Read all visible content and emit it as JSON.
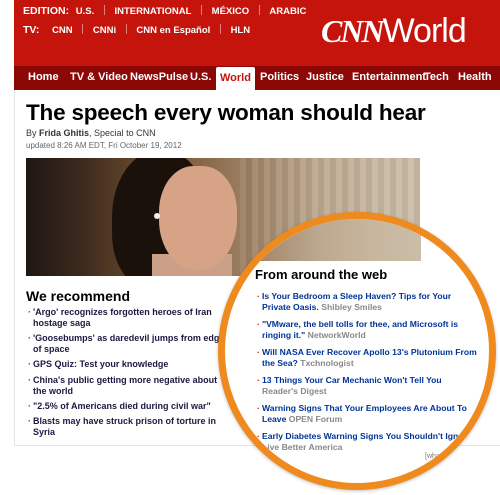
{
  "header": {
    "edition_label": "EDITION:",
    "edition_current": "U.S.",
    "editions": [
      "INTERNATIONAL",
      "MÉXICO",
      "ARABIC"
    ],
    "tv_label": "TV:",
    "tv_channels": [
      "CNN",
      "CNNi",
      "CNN en Español",
      "HLN"
    ],
    "logo_cnn": "CNN",
    "logo_section": "World"
  },
  "nav": {
    "items": [
      "Home",
      "TV & Video",
      "NewsPulse",
      "U.S.",
      "World",
      "Politics",
      "Justice",
      "Entertainment",
      "Tech",
      "Health"
    ],
    "active": "World"
  },
  "article": {
    "headline": "The speech every woman should hear",
    "byline_prefix": "By",
    "author": "Frida Ghitis",
    "byline_suffix": ", Special to CNN",
    "updated": "updated 8:26 AM EDT, Fri October 19, 2012"
  },
  "recommend": {
    "title": "We recommend",
    "items": [
      "'Argo' recognizes forgotten heroes of Iran hostage saga",
      "'Goosebumps' as daredevil jumps from edge of space",
      "GPS Quiz: Test your knowledge",
      "China's public getting more negative about the world",
      "\"2.5% of Americans died during civil war\"",
      "Blasts may have struck prison of torture in Syria"
    ]
  },
  "around_web": {
    "title": "From around the web",
    "items": [
      {
        "title": "Is Your Bedroom a Sleep Haven? Tips for Your Private Oasis.",
        "source": "Shibley Smiles"
      },
      {
        "title": "\"VMware, the bell tolls for thee, and Microsoft is ringing it.\"",
        "source": "NetworkWorld"
      },
      {
        "title": "Will NASA Ever Recover Apollo 13's Plutonium From the Sea?",
        "source": "Txchnologist"
      },
      {
        "title": "13 Things Your Car Mechanic Won't Tell You",
        "source": "Reader's Digest"
      },
      {
        "title": "Warning Signs That Your Employees Are About To Leave",
        "source": "OPEN Forum"
      },
      {
        "title": "Early Diabetes Warning Signs You Shouldn't Ignore",
        "source": "Live Better America"
      }
    ],
    "whats_this": "[what"
  },
  "colors": {
    "brand_red": "#c4140c",
    "nav_dark_red": "#8c0806",
    "highlight_orange": "#ef8a1e",
    "link_blue": "#003399"
  }
}
